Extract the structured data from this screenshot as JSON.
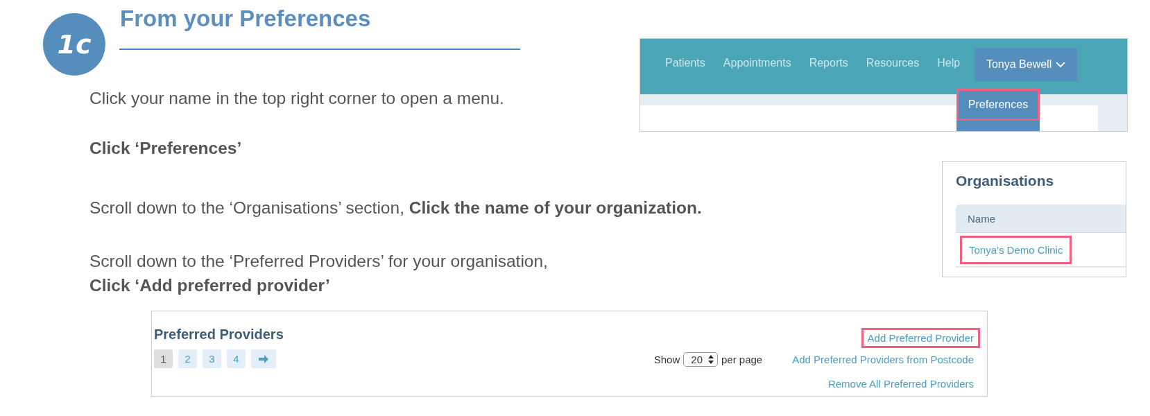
{
  "step": {
    "badge": "1c",
    "title": "From your Preferences"
  },
  "instructions": [
    {
      "text": "Click your name in the top right corner to open a menu.",
      "bold": false
    },
    {
      "text": "Click ‘Preferences’",
      "bold": true
    },
    {
      "text": "Scroll down to the ‘Organisations’ section, **Click the name of your organization.**",
      "bold": false
    },
    {
      "text": "Scroll down to the ‘Preferred Providers’ for your organisation,",
      "bold": false
    },
    {
      "text": "Click ‘Add preferred provider’",
      "bold": true
    }
  ],
  "nav_screenshot": {
    "items": [
      "Patients",
      "Appointments",
      "Reports",
      "Resources",
      "Help"
    ],
    "user": {
      "name": "Tonya Bewell",
      "expanded": true
    },
    "menu": [
      {
        "label": "Preferences",
        "highlighted": true
      }
    ]
  },
  "organisations_screenshot": {
    "title": "Organisations",
    "column": "Name",
    "rows": [
      {
        "name": "Tonya's Demo Clinic",
        "highlighted": true
      }
    ]
  },
  "providers_screenshot": {
    "title": "Preferred Providers",
    "pages": [
      {
        "label": "1",
        "selected": true
      },
      {
        "label": "2",
        "selected": false
      },
      {
        "label": "3",
        "selected": false
      },
      {
        "label": "4",
        "selected": false
      }
    ],
    "show_label": "Show",
    "page_size": "20",
    "per_page_label": "per page",
    "links": [
      {
        "label": "Add Preferred Provider",
        "highlighted": true
      },
      {
        "label": "Add Preferred Providers from Postcode",
        "highlighted": false
      },
      {
        "label": "Remove All Preferred Providers",
        "highlighted": false
      }
    ]
  }
}
